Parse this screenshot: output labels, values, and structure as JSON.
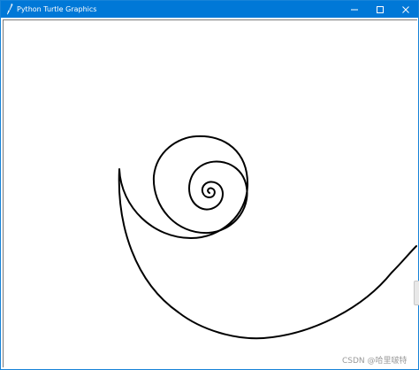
{
  "window": {
    "title": "Python Turtle Graphics",
    "title_bar_color": "#0078d7"
  },
  "controls": {
    "minimize_icon": "minimize-icon",
    "maximize_icon": "maximize-icon",
    "close_icon": "close-icon"
  },
  "canvas": {
    "background": "#ffffff",
    "stroke_color": "#000000",
    "drawing": "spiral"
  },
  "watermark": {
    "text": "CSDN @哈里啵特"
  }
}
